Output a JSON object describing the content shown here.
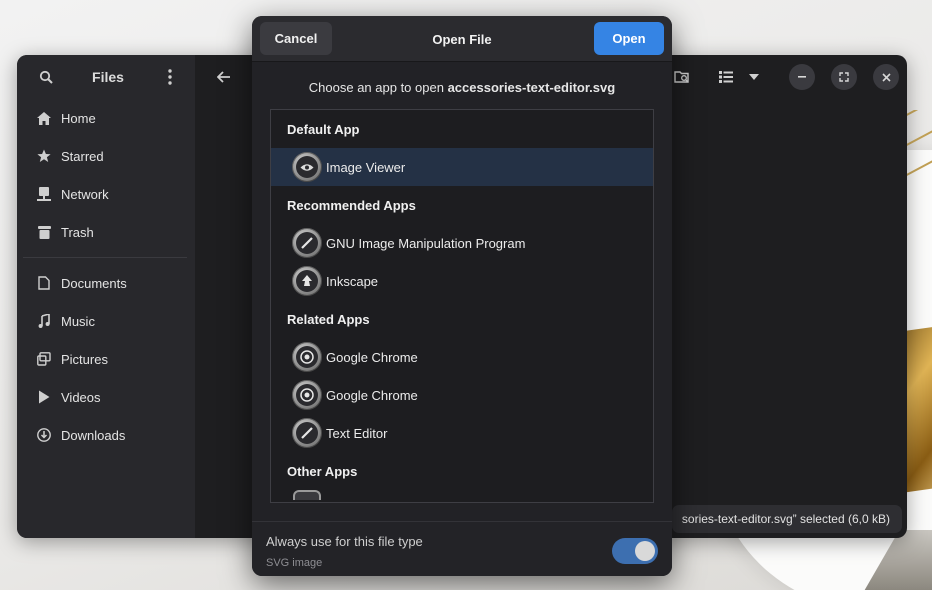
{
  "files_window": {
    "sidebar_title": "Files",
    "sidebar_items_top": [
      {
        "label": "Home",
        "icon": "home-icon"
      },
      {
        "label": "Starred",
        "icon": "star-icon"
      },
      {
        "label": "Network",
        "icon": "network-icon"
      },
      {
        "label": "Trash",
        "icon": "trash-icon"
      }
    ],
    "sidebar_items_bottom": [
      {
        "label": "Documents",
        "icon": "document-icon"
      },
      {
        "label": "Music",
        "icon": "music-icon"
      },
      {
        "label": "Pictures",
        "icon": "pictures-icon"
      },
      {
        "label": "Videos",
        "icon": "videos-icon"
      },
      {
        "label": "Downloads",
        "icon": "download-icon"
      }
    ],
    "status_text": "sories-text-editor.svg” selected  (6,0 kB)"
  },
  "dialog": {
    "title": "Open File",
    "cancel_label": "Cancel",
    "open_label": "Open",
    "subtitle_prefix": "Choose an app to open ",
    "subtitle_file": "accessories-text-editor.svg",
    "sections": {
      "default": "Default App",
      "recommended": "Recommended Apps",
      "related": "Related Apps",
      "other": "Other Apps"
    },
    "apps": {
      "default": [
        "Image Viewer"
      ],
      "recommended": [
        "GNU Image Manipulation Program",
        "Inkscape"
      ],
      "related": [
        "Google Chrome",
        "Google Chrome",
        "Text Editor"
      ]
    },
    "footer_label": "Always use for this file type",
    "footer_sub": "SVG image",
    "toggle_on": true,
    "accent_color": "#3584e4"
  }
}
